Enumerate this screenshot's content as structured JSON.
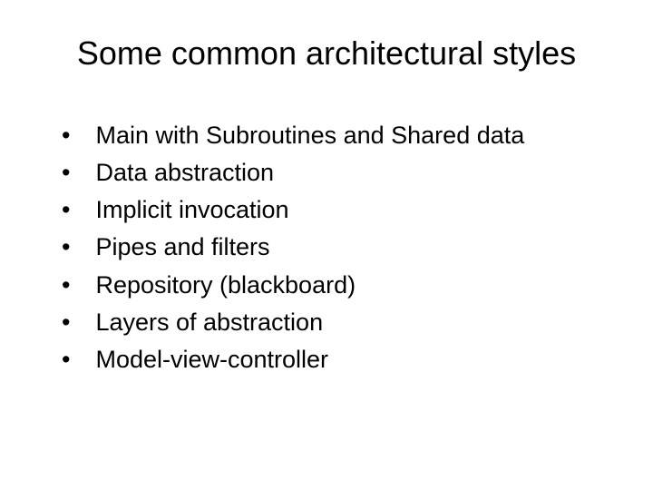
{
  "slide": {
    "title": "Some common architectural styles",
    "bullets": [
      "Main with Subroutines and Shared data",
      "Data abstraction",
      "Implicit invocation",
      "Pipes and filters",
      "Repository (blackboard)",
      "Layers of abstraction",
      "Model-view-controller"
    ]
  }
}
